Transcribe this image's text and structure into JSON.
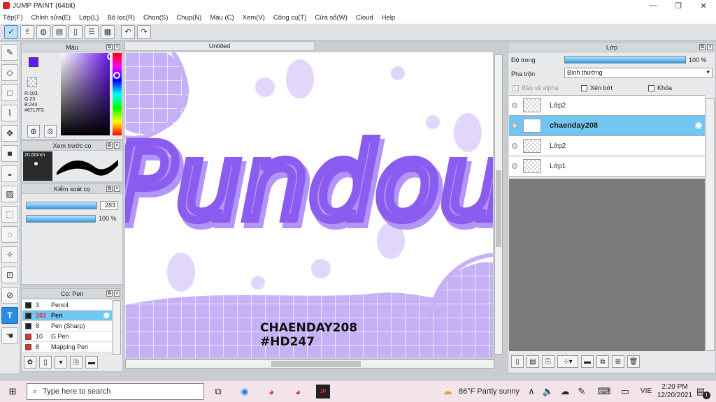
{
  "window": {
    "title": "JUMP PAINT (64bit)",
    "min": "—",
    "max": "❐",
    "close": "✕"
  },
  "menu": [
    "Tệp(F)",
    "Chỉnh sửa(E)",
    "Lớp(L)",
    "Bộ lọc(R)",
    "Chọn(S)",
    "Chụp(N)",
    "Màu (C)",
    "Xem(V)",
    "Công cụ(T)",
    "Cửa sổ(W)",
    "Cloud",
    "Help"
  ],
  "color_panel": {
    "title": "Màu",
    "r": "R:103",
    "g": "G:23",
    "b": "B:243",
    "hex": "#6717F3",
    "fg_color": "#6717F3",
    "bg_color": "#f4a6c8"
  },
  "brush_preview": {
    "title": "Xem trước cọ",
    "size": "20.60mm"
  },
  "brush_control": {
    "title": "Kiểm soát cọ",
    "size_value": "283",
    "opacity_value": "100 %"
  },
  "brush_list": {
    "title": "Cọ: Pen",
    "items": [
      {
        "num": "3",
        "name": "Pencil",
        "color": "#222222",
        "num_color": "#222"
      },
      {
        "num": "283",
        "name": "Pen",
        "color": "#222222",
        "num_color": "#e0284a"
      },
      {
        "num": "8",
        "name": "Pen (Sharp)",
        "color": "#222222",
        "num_color": "#222"
      },
      {
        "num": "10",
        "name": "G Pen",
        "color": "#e83030",
        "num_color": "#222"
      },
      {
        "num": "8",
        "name": "Mapping Pen",
        "color": "#e83030",
        "num_color": "#222"
      }
    ]
  },
  "canvas": {
    "tab": "Untitled",
    "art_title": "Pundou",
    "art_credit_1": "CHAENDAY208",
    "art_credit_2": "#HD247",
    "accent": "#8a5cf0"
  },
  "layers": {
    "title": "Lớp",
    "opacity_label": "Độ trong",
    "opacity_value": "100 %",
    "blend_label": "Pha trộn",
    "blend_value": "Bình thường",
    "protect_alpha": "Bảo vệ alpha",
    "clip": "Xén bớt",
    "lock": "Khóa",
    "items": [
      {
        "name": "Lớp2"
      },
      {
        "name": "chaenday208"
      },
      {
        "name": "Lớp2"
      },
      {
        "name": "Lớp1"
      }
    ]
  },
  "taskbar": {
    "search_placeholder": "Type here to search",
    "weather": "86°F  Partly sunny",
    "lang": "VIE",
    "time": "2:20 PM",
    "date": "12/20/2021",
    "notif": "1"
  }
}
